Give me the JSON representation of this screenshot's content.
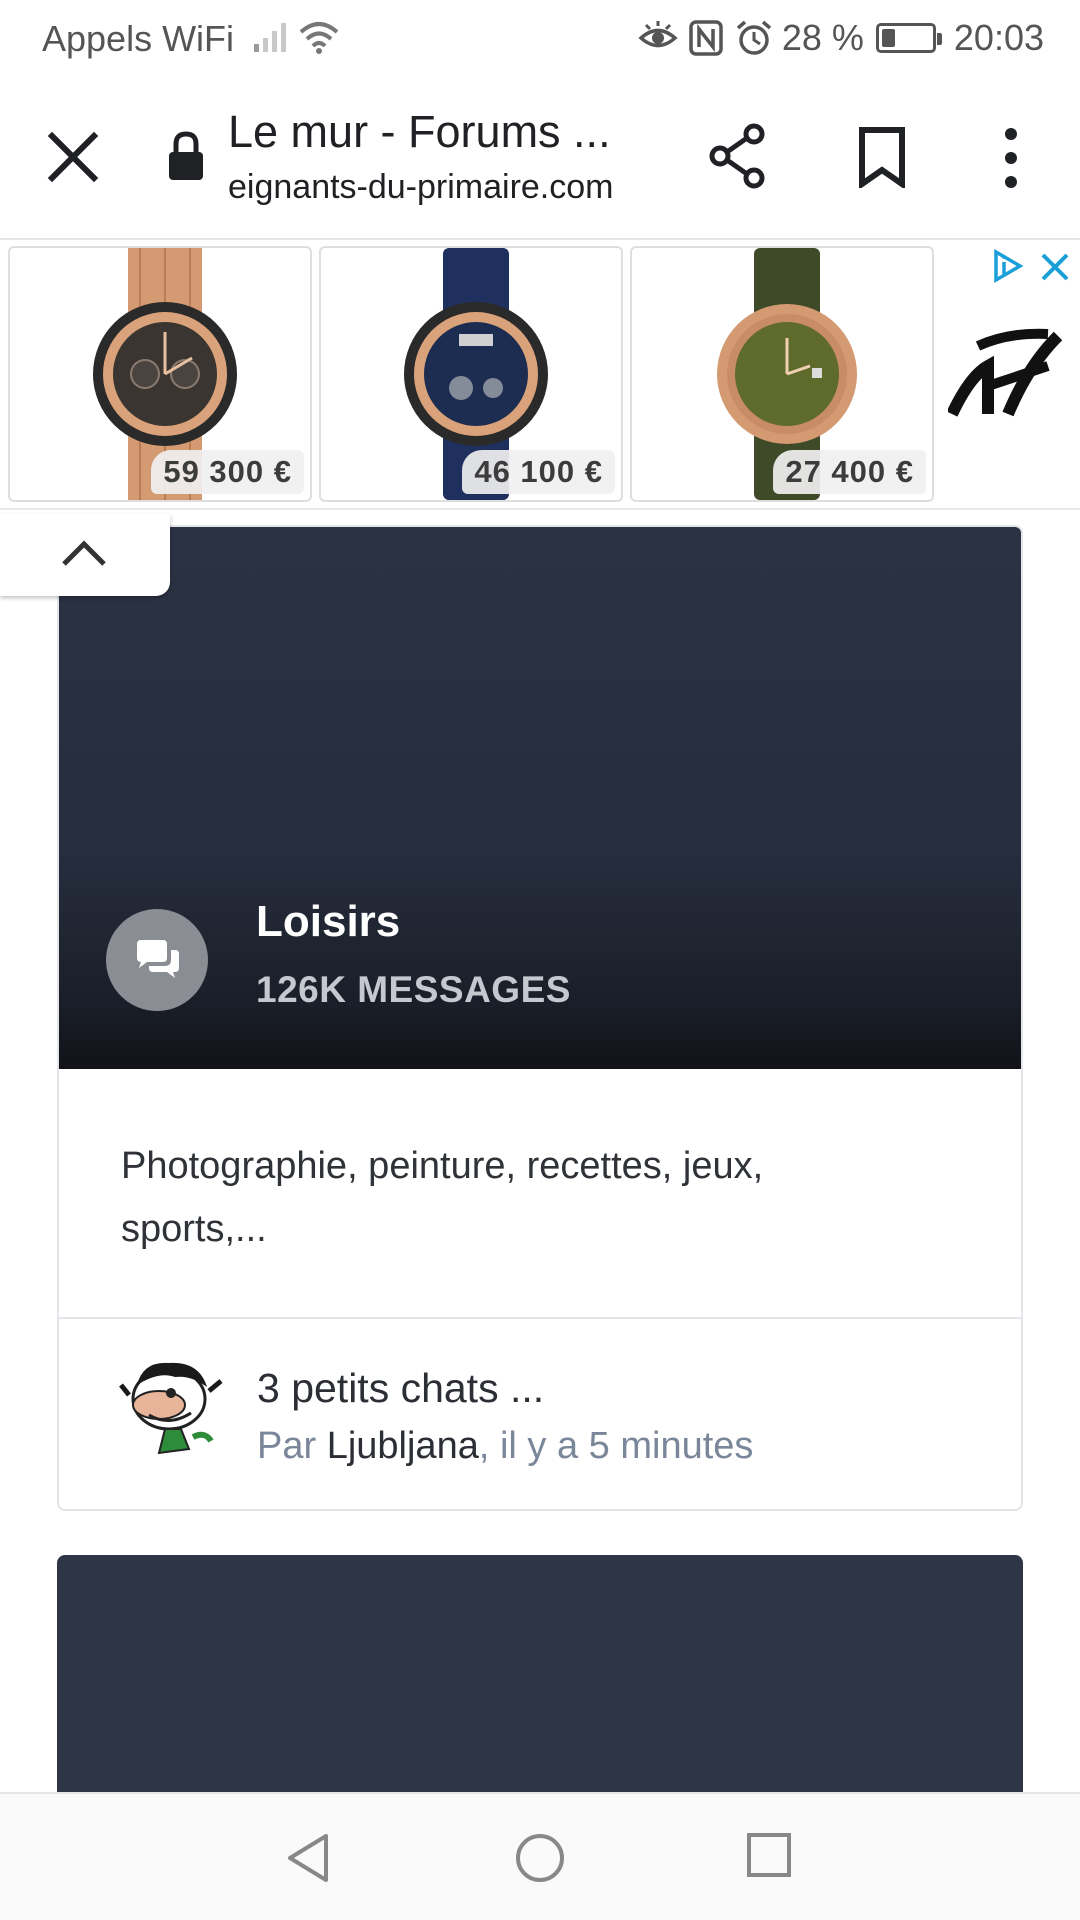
{
  "status_bar": {
    "carrier": "Appels WiFi",
    "battery_percent": "28 %",
    "battery_level": 0.28,
    "time": "20:03",
    "icons": [
      "signal-icon",
      "wifi-icon",
      "eye-icon",
      "nfc-icon",
      "alarm-icon",
      "battery-icon"
    ]
  },
  "toolbar": {
    "title": "Le mur - Forums ...",
    "url": "eignants-du-primaire.com",
    "icons": [
      "close-icon",
      "lock-icon",
      "share-icon",
      "bookmark-icon",
      "more-vert-icon"
    ]
  },
  "ad": {
    "products": [
      {
        "price": "59 300 €",
        "dial_color": "#3a3530",
        "strap": "gold-bracelet"
      },
      {
        "price": "46 100 €",
        "dial_color": "#1d2d52",
        "strap": "blue-rubber"
      },
      {
        "price": "27 400 €",
        "dial_color": "#5e6b2a",
        "strap": "green-rubber"
      }
    ],
    "icons": [
      "adchoices-icon",
      "close-icon",
      "brand-logo"
    ]
  },
  "forum": {
    "title": "Loisirs",
    "message_count": "126K MESSAGES",
    "description": "Photographie, peinture, recettes, jeux, sports,...",
    "last_post": {
      "title": "3 petits chats ...",
      "by_prefix": "Par ",
      "user": "Ljubljana",
      "time_suffix": ", il y a 5 minutes"
    }
  },
  "colors": {
    "hero_dark": "#262d3d",
    "meta_grey": "#7a8699",
    "accent_cyan": "#1a9fd8"
  },
  "nav_bar": {
    "icons": [
      "back-icon",
      "home-icon",
      "recents-icon"
    ]
  }
}
